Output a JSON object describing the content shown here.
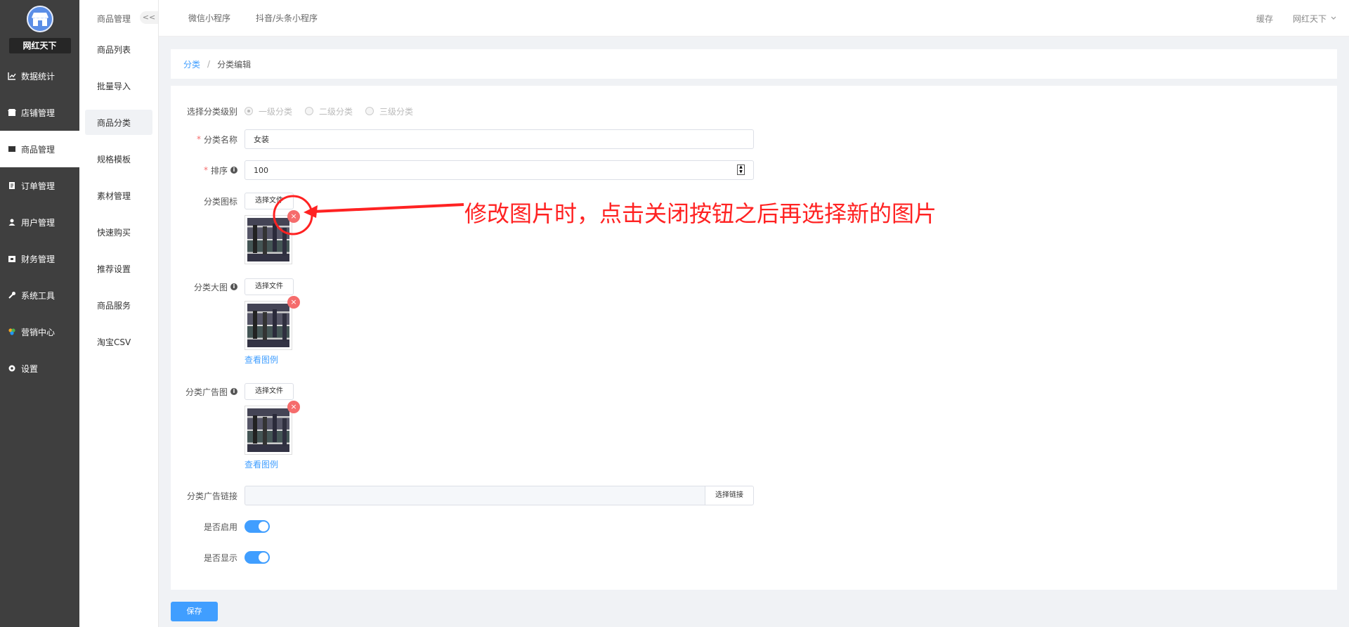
{
  "sidebar": {
    "shop_name": "网红天下",
    "items": [
      {
        "label": "数据统计",
        "icon": "chart-icon"
      },
      {
        "label": "店铺管理",
        "icon": "store-icon"
      },
      {
        "label": "商品管理",
        "icon": "goods-icon"
      },
      {
        "label": "订单管理",
        "icon": "order-icon"
      },
      {
        "label": "用户管理",
        "icon": "user-icon"
      },
      {
        "label": "财务管理",
        "icon": "finance-icon"
      },
      {
        "label": "系统工具",
        "icon": "wrench-icon"
      },
      {
        "label": "营销中心",
        "icon": "marketing-icon"
      },
      {
        "label": "设置",
        "icon": "gear-icon"
      }
    ],
    "active_index": 2
  },
  "submenu": {
    "title": "商品管理",
    "collapse_label": "<<",
    "items": [
      "商品列表",
      "批量导入",
      "商品分类",
      "规格模板",
      "素材管理",
      "快速购买",
      "推荐设置",
      "商品服务",
      "淘宝CSV"
    ],
    "active_index": 2
  },
  "topbar": {
    "tabs": [
      "微信小程序",
      "抖音/头条小程序"
    ],
    "cache": "缓存",
    "user": "网红天下"
  },
  "breadcrumb": {
    "parent": "分类",
    "separator": "/",
    "current": "分类编辑"
  },
  "form": {
    "level_label": "选择分类级别",
    "levels": [
      "一级分类",
      "二级分类",
      "三级分类"
    ],
    "name_label": "分类名称",
    "name_value": "女装",
    "sort_label": "排序",
    "sort_value": "100",
    "icon_label": "分类图标",
    "big_image_label": "分类大图",
    "ad_image_label": "分类广告图",
    "ad_link_label": "分类广告链接",
    "choose_file": "选择文件",
    "view_example": "查看图例",
    "choose_link": "选择链接",
    "enabled_label": "是否启用",
    "display_label": "是否显示",
    "enabled": true,
    "display": true,
    "close_symbol": "×",
    "info_symbol": "i",
    "required_symbol": "*"
  },
  "save_label": "保存",
  "annotation": "修改图片时，点击关闭按钮之后再选择新的图片",
  "colors": {
    "sidebar_bg": "#3f3f3f",
    "accent": "#409eff",
    "danger": "#f56c6c",
    "annotation": "#ff2222"
  }
}
